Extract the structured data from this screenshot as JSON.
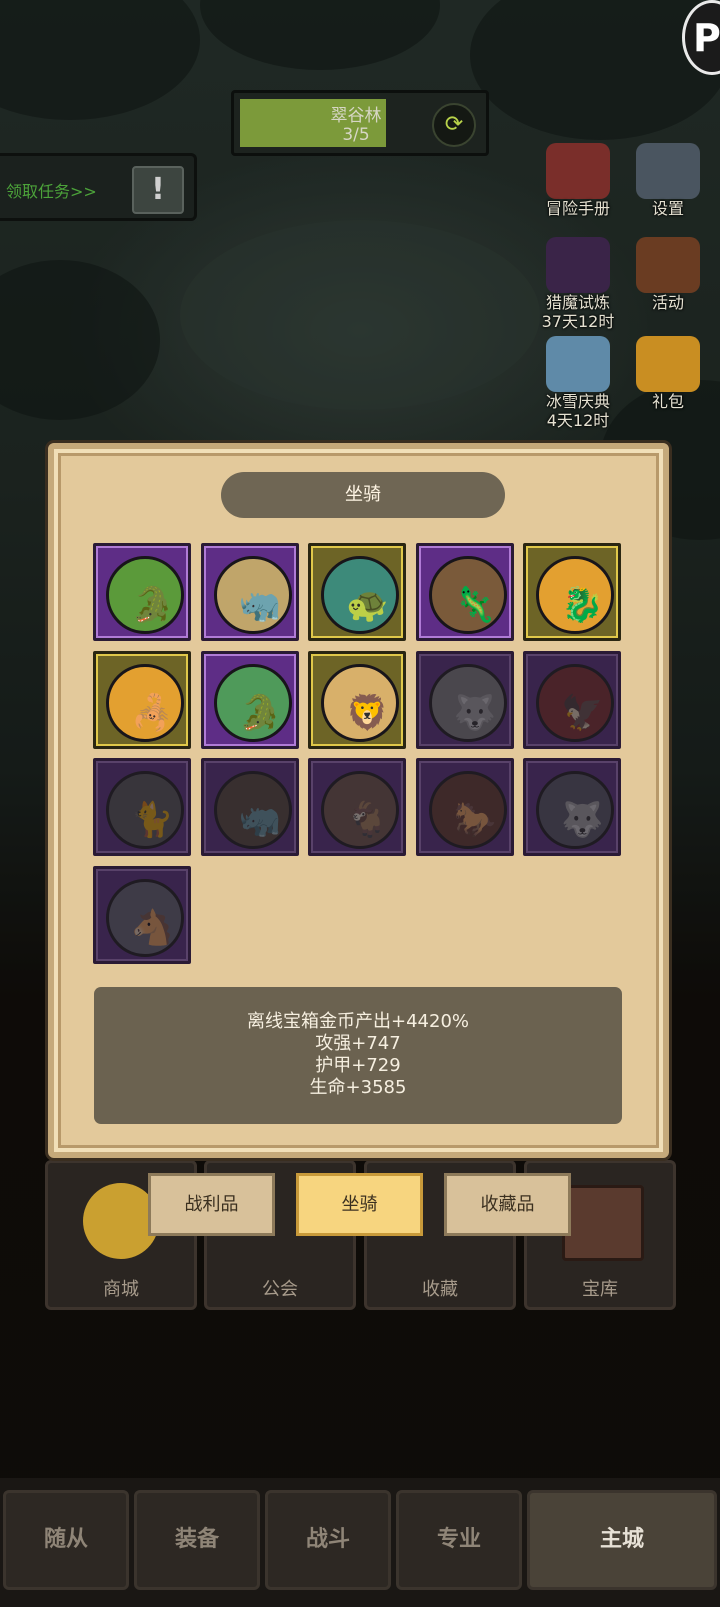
{
  "zone": {
    "name": "翠谷林",
    "progress_text": "3/5",
    "progress_fraction": 0.6
  },
  "quest": {
    "label": "领取任务>>",
    "alert_glyph": "!"
  },
  "corner_badge_glyph": "P",
  "side_icons": [
    {
      "name": "adventure-manual",
      "label": "冒险手册",
      "sub": "",
      "color": "#7a2e2a"
    },
    {
      "name": "settings",
      "label": "设置",
      "sub": "",
      "color": "#4a5560"
    },
    {
      "name": "demon-trial",
      "label": "猎魔试炼",
      "sub": "37天12时",
      "color": "#3a2448"
    },
    {
      "name": "activity",
      "label": "活动",
      "sub": "",
      "color": "#6a3c22"
    },
    {
      "name": "ice-snow-festival",
      "label": "冰雪庆典",
      "sub": "4天12时",
      "color": "#5f8aa8"
    },
    {
      "name": "gift-pack",
      "label": "礼包",
      "sub": "",
      "color": "#c98e22"
    }
  ],
  "modal": {
    "title": "坐骑",
    "mounts": [
      {
        "frame": "purple",
        "bg": "#5b9a3a",
        "icon": "🐊",
        "locked": false
      },
      {
        "frame": "purple",
        "bg": "#c0a56a",
        "icon": "🦏",
        "locked": false
      },
      {
        "frame": "gold",
        "bg": "#3d8a7a",
        "icon": "🐢",
        "locked": false
      },
      {
        "frame": "purple",
        "bg": "#7a5a3a",
        "icon": "🦎",
        "locked": false
      },
      {
        "frame": "gold",
        "bg": "#e3a030",
        "icon": "🐉",
        "locked": false
      },
      {
        "frame": "gold",
        "bg": "#e3a030",
        "icon": "🦂",
        "locked": false
      },
      {
        "frame": "purple",
        "bg": "#4f9a5a",
        "icon": "🐊",
        "locked": false
      },
      {
        "frame": "gold",
        "bg": "#d8b06a",
        "icon": "🦁",
        "locked": false
      },
      {
        "frame": "purple",
        "bg": "#8a8a8a",
        "icon": "🐺",
        "locked": true
      },
      {
        "frame": "purple",
        "bg": "#8a2a2a",
        "icon": "🦅",
        "locked": true
      },
      {
        "frame": "purple",
        "bg": "#5a5a5a",
        "icon": "🐈",
        "locked": true
      },
      {
        "frame": "purple",
        "bg": "#5a4a3a",
        "icon": "🦏",
        "locked": true
      },
      {
        "frame": "purple",
        "bg": "#7a5a4a",
        "icon": "🐐",
        "locked": true
      },
      {
        "frame": "purple",
        "bg": "#6a3a2a",
        "icon": "🐎",
        "locked": true
      },
      {
        "frame": "purple",
        "bg": "#5a5a6a",
        "icon": "🐺",
        "locked": true
      },
      {
        "frame": "purple",
        "bg": "#6a6a7a",
        "icon": "🐴",
        "locked": true
      }
    ],
    "stats": [
      "离线宝箱金币产出+4420%",
      "攻强+747",
      "护甲+729",
      "生命+3585"
    ]
  },
  "tabs": [
    {
      "label": "战利品",
      "active": false
    },
    {
      "label": "坐骑",
      "active": true
    },
    {
      "label": "收藏品",
      "active": false
    }
  ],
  "hub": [
    "商城",
    "公会",
    "收藏",
    "宝库"
  ],
  "nav": [
    {
      "label": "随从",
      "active": false
    },
    {
      "label": "装备",
      "active": false
    },
    {
      "label": "战斗",
      "active": false
    },
    {
      "label": "专业",
      "active": false
    },
    {
      "label": "主城",
      "active": true
    }
  ]
}
